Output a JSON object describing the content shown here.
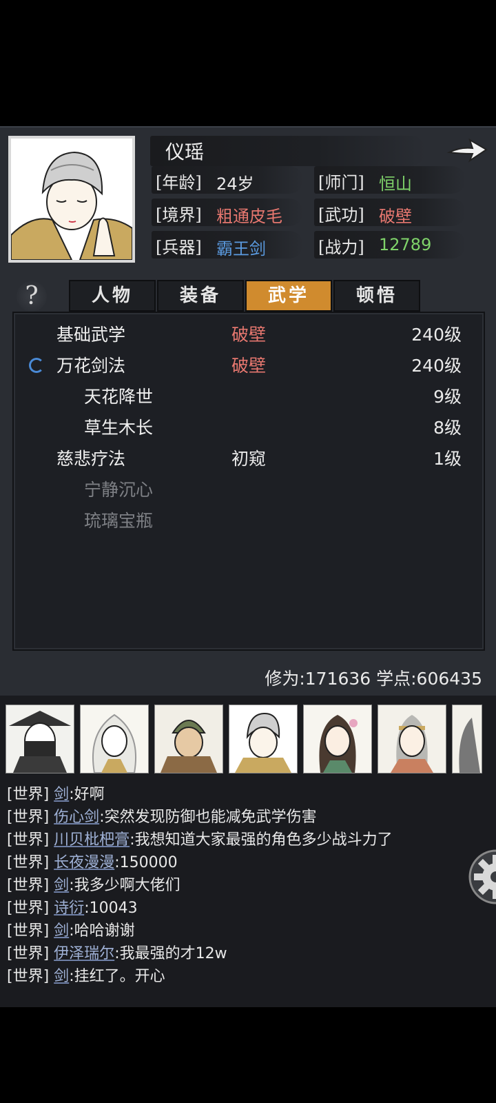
{
  "character": {
    "name": "仪瑶",
    "stats": {
      "age_label": "[年龄]",
      "age_value": "24岁",
      "school_label": "[师门]",
      "school_value": "恒山",
      "realm_label": "[境界]",
      "realm_value": "粗通皮毛",
      "kungfu_label": "[武功]",
      "kungfu_value": "破壁",
      "weapon_label": "[兵器]",
      "weapon_value": "霸王剑",
      "power_label": "[战力]",
      "power_value": "12789"
    }
  },
  "tabs": [
    {
      "label": "人物",
      "active": false
    },
    {
      "label": "装备",
      "active": false
    },
    {
      "label": "武学",
      "active": true
    },
    {
      "label": "顿悟",
      "active": false
    }
  ],
  "help_label": "?",
  "skills": [
    {
      "name": "基础武学",
      "tier": "破壁",
      "level": "240级",
      "indent": 0,
      "tier_color": "#e6776f",
      "dim": false,
      "spinner": false
    },
    {
      "name": "万花剑法",
      "tier": "破壁",
      "level": "240级",
      "indent": 0,
      "tier_color": "#e6776f",
      "dim": false,
      "spinner": true
    },
    {
      "name": "天花降世",
      "tier": "",
      "level": "9级",
      "indent": 1,
      "tier_color": "#e6776f",
      "dim": false,
      "spinner": false
    },
    {
      "name": "草生木长",
      "tier": "",
      "level": "8级",
      "indent": 1,
      "tier_color": "#e6776f",
      "dim": false,
      "spinner": false
    },
    {
      "name": "慈悲疗法",
      "tier": "初窥",
      "level": "1级",
      "indent": 0,
      "tier_color": "#eaeaea",
      "dim": false,
      "spinner": false
    },
    {
      "name": "宁静沉心",
      "tier": "",
      "level": "",
      "indent": 1,
      "tier_color": "#eaeaea",
      "dim": true,
      "spinner": false
    },
    {
      "name": "琉璃宝瓶",
      "tier": "",
      "level": "",
      "indent": 1,
      "tier_color": "#eaeaea",
      "dim": true,
      "spinner": false
    }
  ],
  "points": {
    "text": "修为:171636  学点:606435"
  },
  "colors": {
    "school": "#7fd36a",
    "kungfu": "#e6776f",
    "weapon": "#5b9be0",
    "power": "#7fd36a",
    "active_tab": "#d08b2e"
  },
  "roster": [
    "masked-swordsman",
    "white-haired-woman",
    "helmeted-warrior",
    "nun",
    "flower-maiden",
    "headband-man",
    "partial-card"
  ],
  "chat": [
    {
      "channel": "[世界]",
      "user": "剑",
      "text": ":好啊"
    },
    {
      "channel": "[世界]",
      "user": "伤心剑",
      "text": ":突然发现防御也能减免武学伤害"
    },
    {
      "channel": "[世界]",
      "user": "川贝枇杷膏",
      "text": ":我想知道大家最强的角色多少战斗力了"
    },
    {
      "channel": "[世界]",
      "user": "长夜漫漫",
      "text": ":150000"
    },
    {
      "channel": "[世界]",
      "user": "剑",
      "text": ":我多少啊大佬们"
    },
    {
      "channel": "[世界]",
      "user": "诗衍",
      "text": ":10043"
    },
    {
      "channel": "[世界]",
      "user": "剑",
      "text": ":哈哈谢谢"
    },
    {
      "channel": "[世界]",
      "user": "伊泽瑞尔",
      "text": ":我最强的才12w"
    },
    {
      "channel": "[世界]",
      "user": "剑",
      "text": ":挂红了。开心"
    }
  ]
}
